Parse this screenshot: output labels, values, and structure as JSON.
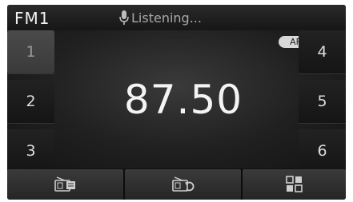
{
  "header": {
    "band": "FM1",
    "status": "Listening..."
  },
  "main": {
    "af_label": "AF",
    "frequency": "87.50"
  },
  "presets": {
    "left": [
      "1",
      "2",
      "3"
    ],
    "right": [
      "4",
      "5",
      "6"
    ],
    "active_index": 0
  },
  "icons": {
    "mic": "microphone-icon",
    "radio_list": "radio-list-icon",
    "radio_scan": "radio-scan-icon",
    "menu": "menu-grid-icon"
  },
  "colors": {
    "background": "#111111",
    "text": "#f4f4f4",
    "badge": "#d8d8d8"
  }
}
